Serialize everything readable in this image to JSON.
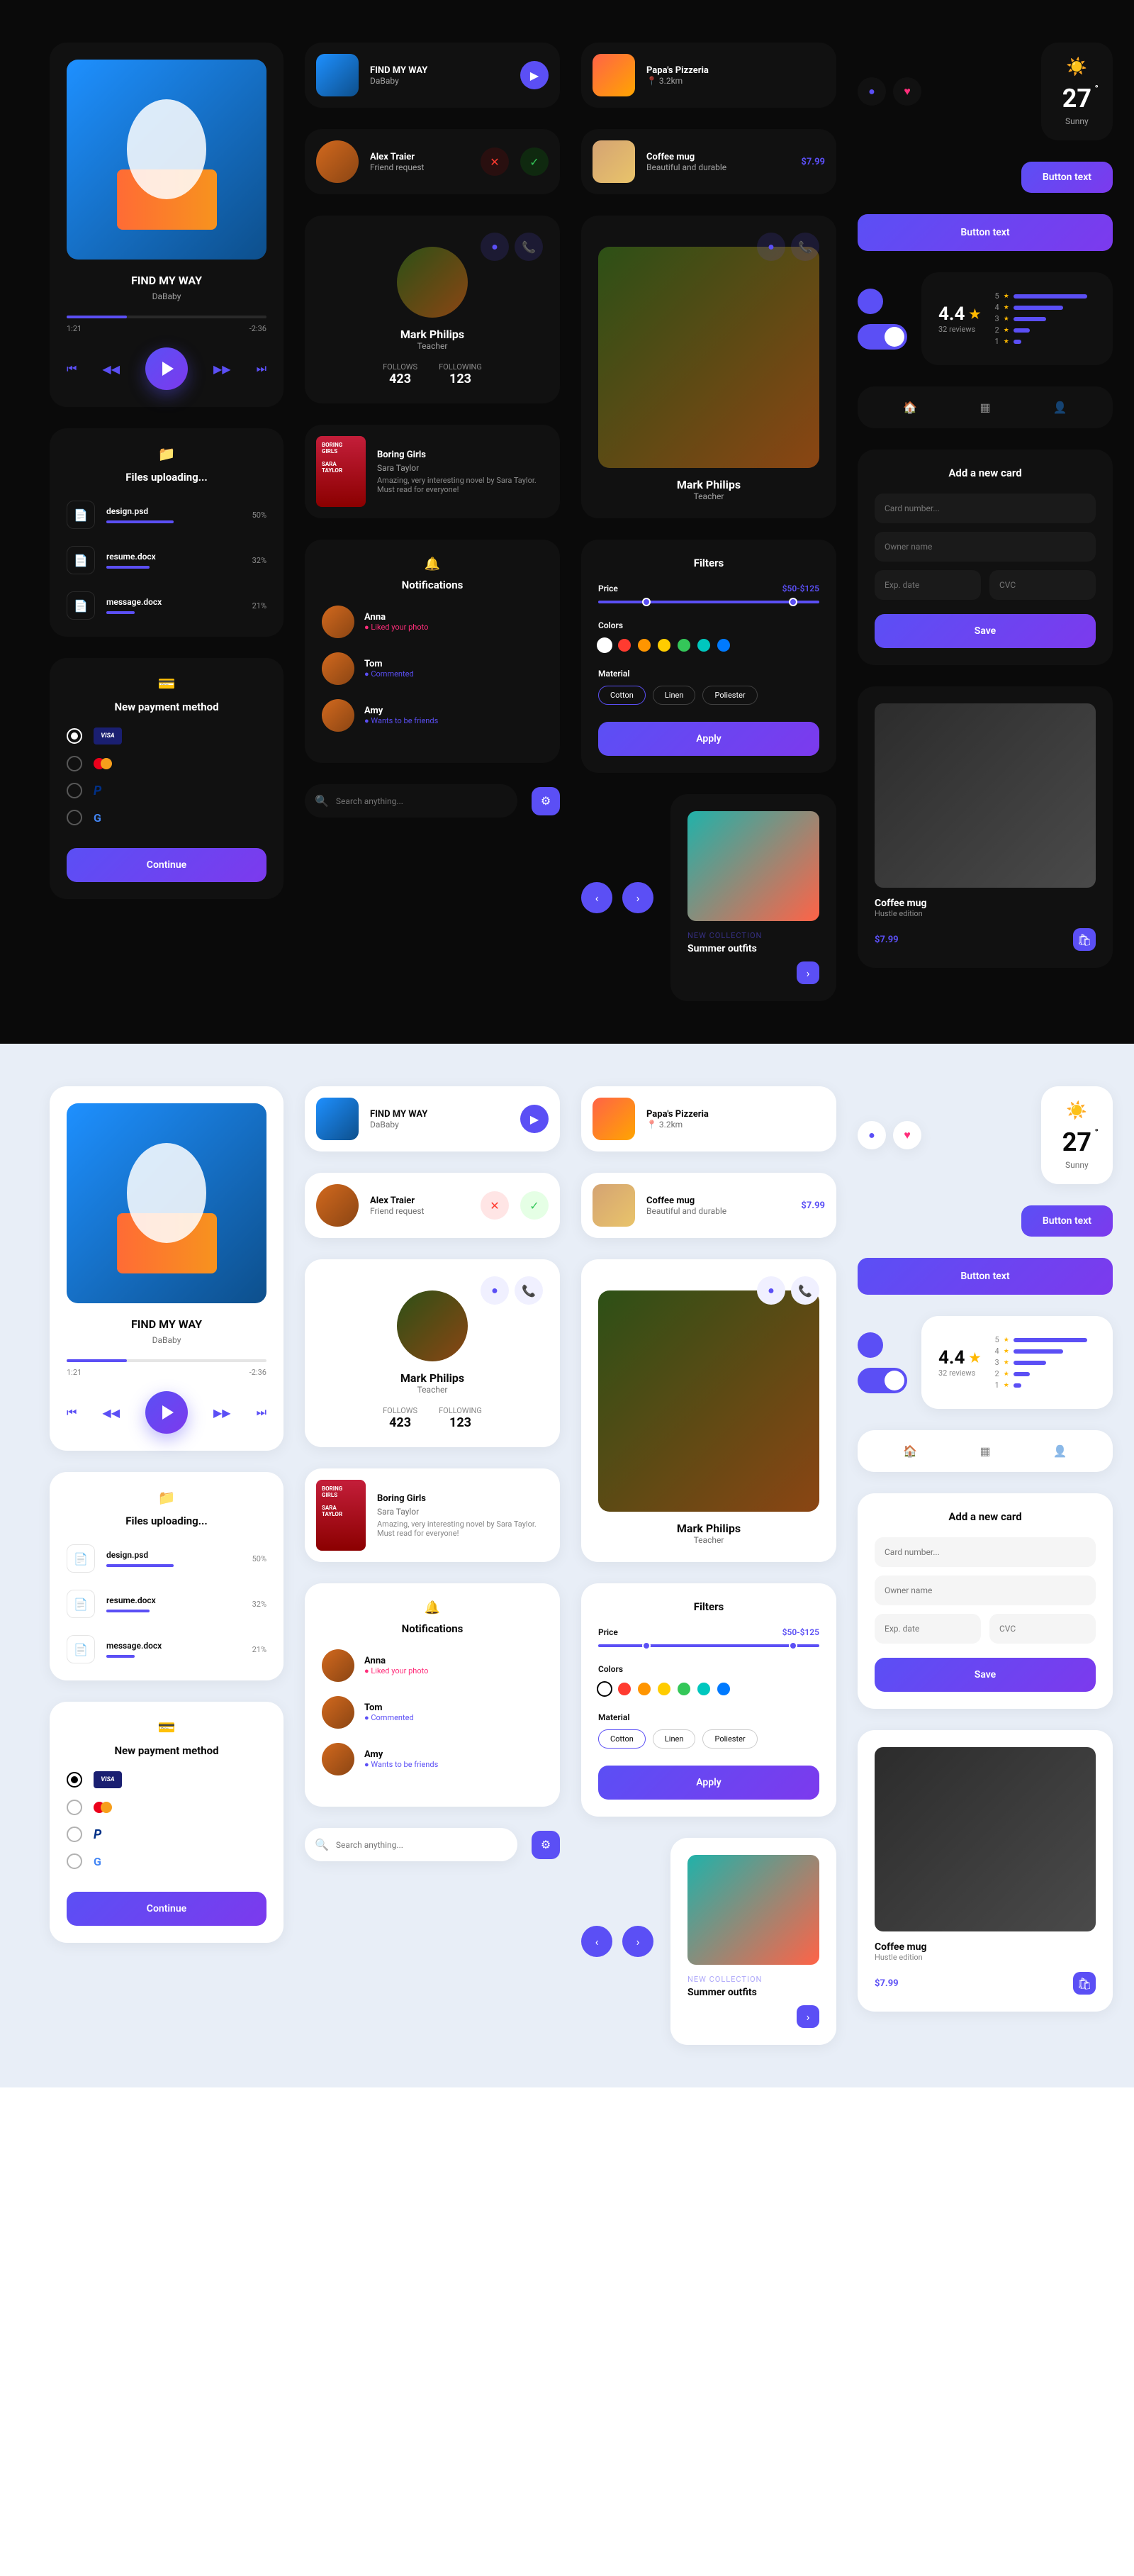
{
  "player": {
    "title": "FIND MY WAY",
    "artist": "DaBaby",
    "t1": "1:21",
    "t2": "-2:36"
  },
  "musicCard": {
    "title": "FIND MY WAY",
    "artist": "DaBaby"
  },
  "friendReq": {
    "name": "Alex Traier",
    "label": "Friend request"
  },
  "restaurant": {
    "name": "Papa's Pizzeria",
    "dist": "3.2km"
  },
  "product": {
    "name": "Coffee mug",
    "desc": "Beautiful and durable",
    "price": "$7.99"
  },
  "profile": {
    "name": "Mark Philips",
    "role": "Teacher",
    "followsLabel": "FOLLOWS",
    "followingLabel": "FOLLOWING",
    "follows": "423",
    "following": "123"
  },
  "files": {
    "title": "Files uploading...",
    "items": [
      {
        "name": "design.psd",
        "pct": "50%",
        "w": "50%"
      },
      {
        "name": "resume.docx",
        "pct": "32%",
        "w": "32%"
      },
      {
        "name": "message.docx",
        "pct": "21%",
        "w": "21%"
      }
    ]
  },
  "payment": {
    "title": "New payment method",
    "btn": "Continue",
    "opts": [
      "visa",
      "mc",
      "paypal",
      "google"
    ]
  },
  "book": {
    "title": "Boring Girls",
    "author": "Sara Taylor",
    "review": "Amazing, very interesting novel by Sara Taylor. Must read for everyone!"
  },
  "notif": {
    "title": "Notifications",
    "items": [
      {
        "name": "Anna",
        "action": "Liked your photo",
        "color": "#ff2d7a"
      },
      {
        "name": "Tom",
        "action": "Commented",
        "color": "#5b4ff5"
      },
      {
        "name": "Amy",
        "action": "Wants to be friends",
        "color": "#5b4ff5"
      }
    ]
  },
  "search": {
    "placeholder": "Search anything..."
  },
  "filters": {
    "title": "Filters",
    "priceLabel": "Price",
    "priceRange": "$50-$125",
    "colorsLabel": "Colors",
    "matLabel": "Material",
    "mats": [
      "Cotton",
      "Linen",
      "Poliester"
    ],
    "apply": "Apply",
    "colors": [
      "#fff",
      "#ff3b30",
      "#ff9500",
      "#ffcc00",
      "#34c759",
      "#00c7be",
      "#007aff"
    ]
  },
  "addCard": {
    "title": "Add a new card",
    "num": "Card number...",
    "owner": "Owner name",
    "exp": "Exp. date",
    "cvc": "CVC",
    "save": "Save"
  },
  "weather": {
    "temp": "27",
    "cond": "Sunny"
  },
  "btnText": "Button text",
  "rating": {
    "score": "4.4",
    "reviews": "32 reviews",
    "bars": [
      {
        "n": "5",
        "w": "90%"
      },
      {
        "n": "4",
        "w": "60%"
      },
      {
        "n": "3",
        "w": "40%"
      },
      {
        "n": "2",
        "w": "20%"
      },
      {
        "n": "1",
        "w": "10%"
      }
    ]
  },
  "summer": {
    "tag": "NEW COLLECTION",
    "title": "Summer outfits"
  },
  "mugCard": {
    "name": "Coffee mug",
    "sub": "Hustle edition",
    "price": "$7.99"
  }
}
